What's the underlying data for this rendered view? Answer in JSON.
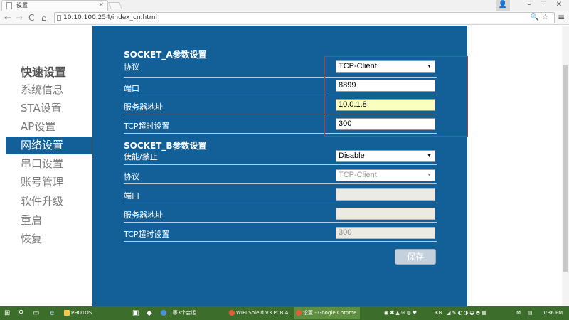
{
  "browser": {
    "tab_title": "设置",
    "tab_close": "×",
    "url": "10.10.100.254/index_cn.html",
    "window_controls": {
      "user": "👤",
      "minimize": "–",
      "maximize": "☐",
      "close": "✕"
    },
    "nav": {
      "back": "←",
      "forward": "→",
      "reload": "C",
      "home": "⌂"
    },
    "omnibox_icons": "🔍☆",
    "menu": "≡"
  },
  "sidebar": {
    "items": [
      {
        "label": "快速设置"
      },
      {
        "label": "系统信息"
      },
      {
        "label": "STA设置"
      },
      {
        "label": "AP设置"
      },
      {
        "label": "网络设置"
      },
      {
        "label": "串口设置"
      },
      {
        "label": "账号管理"
      },
      {
        "label": "软件升级"
      },
      {
        "label": "重启"
      },
      {
        "label": "恢复"
      }
    ]
  },
  "socket_a": {
    "title": "SOCKET_A参数设置",
    "protocol_label": "协议",
    "protocol_value": "TCP-Client",
    "port_label": "端口",
    "port_value": "8899",
    "server_label": "服务器地址",
    "server_value": "10.0.1.8",
    "timeout_label": "TCP超时设置",
    "timeout_value": "300"
  },
  "socket_b": {
    "title": "SOCKET_B参数设置",
    "enable_label": "使能/禁止",
    "enable_value": "Disable",
    "protocol_label": "协议",
    "protocol_value": "TCP-Client",
    "port_label": "端口",
    "port_value": "",
    "server_label": "服务器地址",
    "server_value": "",
    "timeout_label": "TCP超时设置",
    "timeout_value": "300"
  },
  "save_label": "保存",
  "taskbar": {
    "start": "⊞",
    "search": "⚲",
    "task_view": "▭",
    "ie": "e",
    "items": [
      {
        "label": "PHOTOS"
      },
      {
        "label": "...等3个会话"
      },
      {
        "label": "WIFI Shield V3 PCB A..."
      },
      {
        "label": "设置 - Google Chrome"
      }
    ],
    "tray_text": "KB",
    "tray_lang": "M",
    "time": "1:36 PM"
  }
}
